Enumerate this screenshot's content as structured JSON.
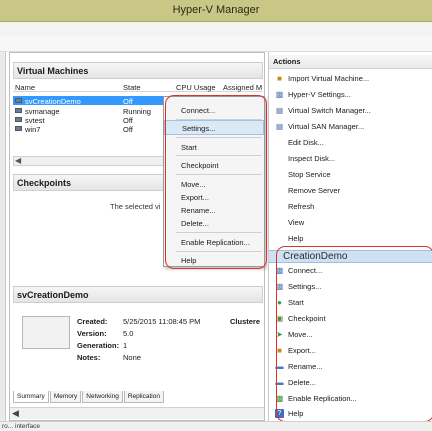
{
  "window": {
    "title": "Hyper-V Manager"
  },
  "vm_panel": {
    "title": "Virtual Machines",
    "columns": [
      "Name",
      "State",
      "CPU Usage",
      "Assigned M"
    ],
    "rows": [
      {
        "name": "svCreationDemo",
        "state": "Off"
      },
      {
        "name": "svmanage",
        "state": "Running"
      },
      {
        "name": "svtest",
        "state": "Off"
      },
      {
        "name": "win7",
        "state": "Off"
      }
    ]
  },
  "checkpoints_panel": {
    "title": "Checkpoints",
    "message": "The selected vi"
  },
  "summary_panel": {
    "title": "svCreationDemo",
    "fields": {
      "created_label": "Created:",
      "created_value": "5/25/2015 11:08:45 PM",
      "version_label": "Version:",
      "version_value": "5.0",
      "generation_label": "Generation:",
      "generation_value": "1",
      "notes_label": "Notes:",
      "notes_value": "None"
    },
    "clustered_label": "Clustere",
    "tabs": [
      "Summary",
      "Memory",
      "Networking",
      "Replication"
    ]
  },
  "context_menu": {
    "items": [
      "Connect...",
      "Settings...",
      "Start",
      "Checkpoint",
      "Move...",
      "Export...",
      "Rename...",
      "Delete...",
      "Enable Replication...",
      "Help"
    ],
    "highlighted": "Settings..."
  },
  "actions_pane": {
    "title": "Actions",
    "host_items": [
      "Import Virtual Machine...",
      "Hyper-V Settings...",
      "Virtual Switch Manager...",
      "Virtual SAN Manager...",
      "Edit Disk...",
      "Inspect Disk...",
      "Stop Service",
      "Remove Server",
      "Refresh",
      "View",
      "Help"
    ],
    "vm_group_title": "CreationDemo",
    "vm_items": [
      "Connect...",
      "Settings...",
      "Start",
      "Checkpoint",
      "Move...",
      "Export...",
      "Rename...",
      "Delete...",
      "Enable Replication...",
      "Help"
    ]
  },
  "status_bar": {
    "text": "ro... interface"
  },
  "colors": {
    "titlebar": "#c8c785",
    "selection": "#3399ff",
    "highlight": "#e0302a",
    "group_header": "#cfe0f3"
  }
}
